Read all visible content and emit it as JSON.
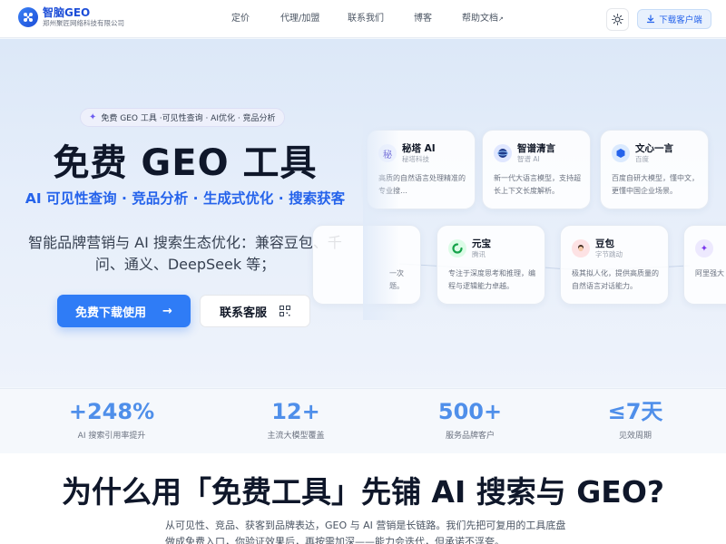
{
  "header": {
    "logo_title": "智脑GEO",
    "logo_subtitle": "郑州聚匠网络科技有限公司",
    "nav": [
      "定价",
      "代理/加盟",
      "联系我们",
      "博客",
      "帮助文档"
    ],
    "nav_external_mark": "↗",
    "theme_icon": "sun-icon",
    "download_label": "下载客户端"
  },
  "hero": {
    "pill": "免费 GEO 工具 ·可见性查询 · AI优化 · 竞品分析",
    "title": "免费 GEO 工具",
    "subtitle": "AI 可见性查询 · 竞品分析 · 生成式优化 · 搜索获客",
    "description": "智能品牌营销与 AI 搜索生态优化：兼容豆包、千问、通义、DeepSeek 等；",
    "primary_button": "免费下载使用",
    "secondary_button": "联系客服",
    "cards_row1": [
      {
        "name": "秘塔 AI",
        "vendor": "秘塔科技",
        "desc": "高质的自然语言处理精准的专业搜…"
      },
      {
        "name": "智谱清言",
        "vendor": "智谱 AI",
        "desc": "新一代大语言模型，支持超长上下文长度解析。"
      },
      {
        "name": "文心一言",
        "vendor": "百度",
        "desc": "百度自研大模型，懂中文，更懂中国企业场景。"
      }
    ],
    "cards_row2": [
      {
        "name": "",
        "vendor": "",
        "desc": "一次题。"
      },
      {
        "name": "元宝",
        "vendor": "腾讯",
        "desc": "专注于深度思考和推理，编程与逻辑能力卓越。"
      },
      {
        "name": "豆包",
        "vendor": "字节跳动",
        "desc": "极其拟人化，提供高质量的自然语言对话能力。"
      },
      {
        "name": "",
        "vendor": "",
        "desc": "阿里强大"
      }
    ]
  },
  "stats": [
    {
      "value": "+248%",
      "label": "AI 搜索引用率提升"
    },
    {
      "value": "12+",
      "label": "主流大模型覆盖"
    },
    {
      "value": "500+",
      "label": "服务品牌客户"
    },
    {
      "value": "≤7天",
      "label": "见效周期"
    }
  ],
  "section": {
    "title": "为什么用「免费工具」先铺 AI 搜索与 GEO?",
    "text": "从可见性、竞品、获客到品牌表达，GEO 与 AI 营销是长链路。我们先把可复用的工具底盘做成免费入口，你验证效果后，再按需加深——能力会迭代，但承诺不浮夸。"
  },
  "colors": {
    "accent": "#2f7cf6",
    "brand": "#1d4ed8",
    "stat": "#4f8fea"
  }
}
